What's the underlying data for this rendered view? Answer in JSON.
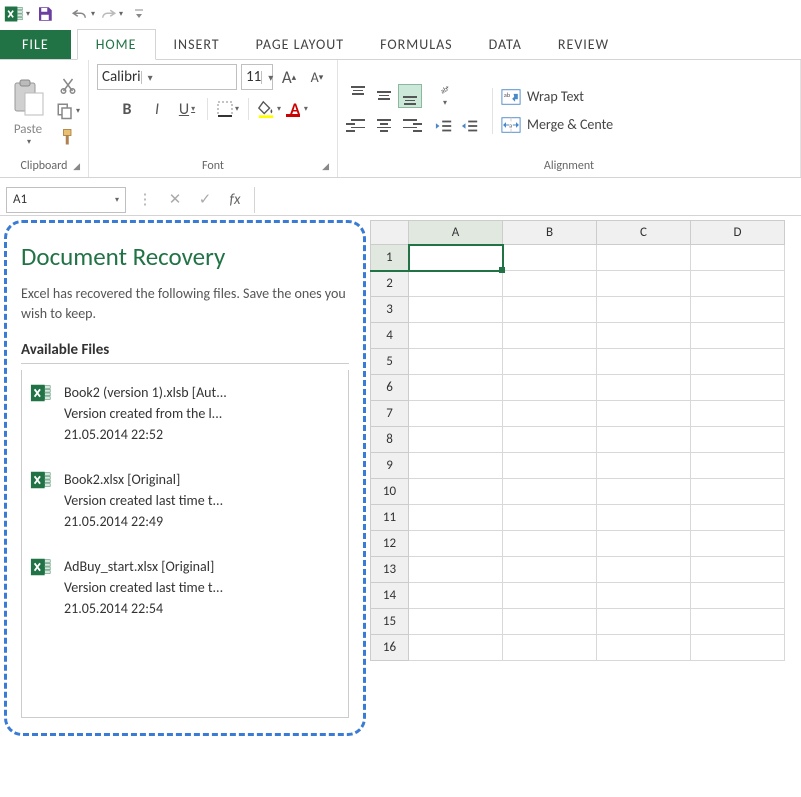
{
  "qat": {
    "save_icon": "save",
    "undo_icon": "undo",
    "redo_icon": "redo"
  },
  "tabs": {
    "file": "FILE",
    "home": "HOME",
    "insert": "INSERT",
    "page_layout": "PAGE LAYOUT",
    "formulas": "FORMULAS",
    "data": "DATA",
    "review": "REVIEW"
  },
  "clipboard": {
    "paste_label": "Paste",
    "group_label": "Clipboard"
  },
  "font": {
    "name_value": "Calibri",
    "size_value": "11",
    "bold": "B",
    "italic": "I",
    "underline": "U",
    "group_label": "Font"
  },
  "alignment": {
    "wrap_label": "Wrap Text",
    "merge_label": "Merge & Cente",
    "group_label": "Alignment"
  },
  "namebox": {
    "value": "A1",
    "fx": "fx"
  },
  "recovery": {
    "title": "Document Recovery",
    "subtitle": "Excel has recovered the following files. Save the ones you wish to keep.",
    "available_label": "Available Files",
    "files": [
      {
        "name": "Book2 (version 1).xlsb  [Aut...",
        "desc": "Version created from the l...",
        "time": "21.05.2014 22:52"
      },
      {
        "name": "Book2.xlsx  [Original]",
        "desc": "Version created last time t...",
        "time": "21.05.2014 22:49"
      },
      {
        "name": "AdBuy_start.xlsx  [Original]",
        "desc": "Version created last time t...",
        "time": "21.05.2014 22:54"
      }
    ]
  },
  "grid": {
    "columns": [
      "A",
      "B",
      "C",
      "D"
    ],
    "rows": [
      "1",
      "2",
      "3",
      "4",
      "5",
      "6",
      "7",
      "8",
      "9",
      "10",
      "11",
      "12",
      "13",
      "14",
      "15",
      "16"
    ],
    "active_col": "A",
    "active_row": "1"
  },
  "colors": {
    "brand": "#217346",
    "highlight_dash": "#3a7bd5"
  }
}
